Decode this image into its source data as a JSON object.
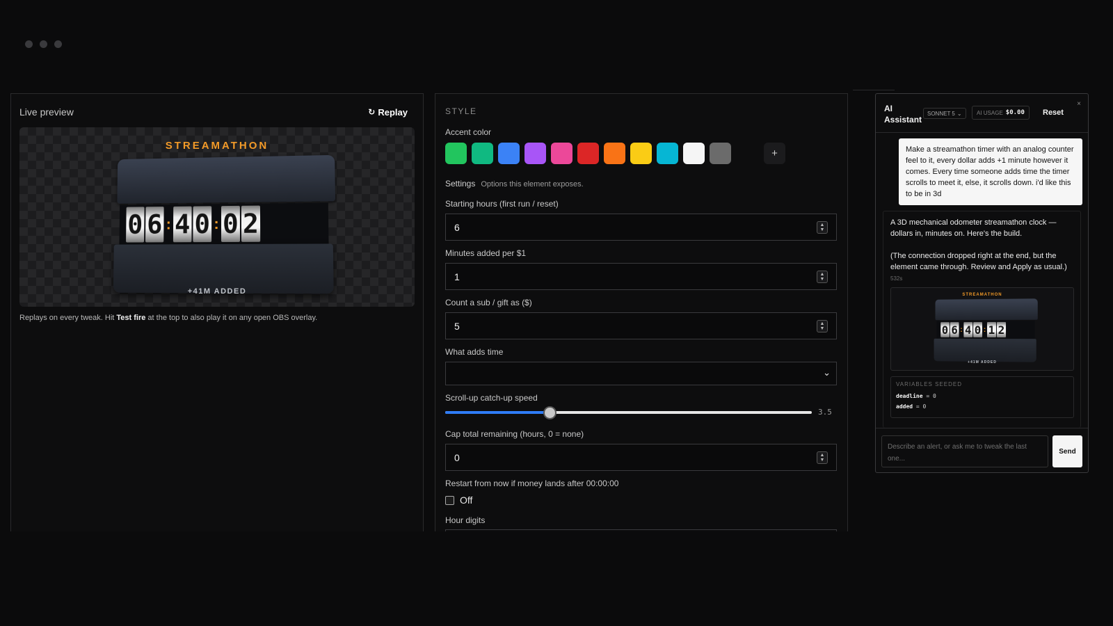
{
  "preview": {
    "title": "Live preview",
    "replay_icon": "↻",
    "replay_label": "Replay",
    "widget_title": "STREAMATHON",
    "digits": [
      "0",
      "6",
      "4",
      "0",
      "0",
      "2"
    ],
    "widget_added": "+41M ADDED",
    "note_before": "Replays on every tweak. Hit ",
    "note_strong": "Test fire",
    "note_after": " at the top to also play it on any open OBS overlay."
  },
  "style": {
    "section_title": "STYLE",
    "accent_label": "Accent color",
    "swatch_colors": [
      "#22c55e",
      "#10b981",
      "#3b82f6",
      "#a855f7",
      "#ec4899",
      "#dc2626",
      "#f97316",
      "#facc15",
      "#06b6d4",
      "#f5f5f5",
      "#6b6b6b"
    ],
    "add_swatch": "+",
    "settings_heading": "Settings",
    "settings_sub": "Options this element exposes.",
    "starting_hours_label": "Starting hours (first run / reset)",
    "starting_hours_value": "6",
    "minutes_per_dollar_label": "Minutes added per $1",
    "minutes_per_dollar_value": "1",
    "sub_gift_label": "Count a sub / gift as ($)",
    "sub_gift_value": "5",
    "what_adds_label": "What adds time",
    "what_adds_value": "",
    "scroll_speed_label": "Scroll-up catch-up speed",
    "scroll_speed_value": "3.5",
    "scroll_speed_fraction": 0.285,
    "cap_label": "Cap total remaining (hours, 0 = none)",
    "cap_value": "0",
    "restart_label": "Restart from now if money lands after 00:00:00",
    "restart_checkbox_label": "Off",
    "hour_digits_label": "Hour digits"
  },
  "ai": {
    "title_line1": "AI",
    "title_line2": "Assistant",
    "model": "SONNET 5",
    "usage_label": "AI USAGE",
    "usage_value": "$0.00",
    "reset_label": "Reset",
    "close_icon": "×",
    "user_message": "Make a streamathon timer with an analog counter feel to it, every dollar adds +1 minute however it comes. Every time someone adds time the timer scrolls to meet it, else, it scrolls down. i'd like this to be in 3d",
    "bot_message_p1": "A 3D mechanical odometer streamathon clock — dollars in, minutes on. Here's the build.",
    "bot_message_p2": "(The connection dropped right at the end, but the element came through. Review and Apply as usual.)",
    "bot_time": "532s",
    "mini_title": "STREAMATHON",
    "mini_digits": [
      "0",
      "6",
      "4",
      "0",
      "1",
      "2"
    ],
    "mini_added": "+41M ADDED",
    "vars_heading": "VARIABLES SEEDED",
    "var1_name": "deadline",
    "var1_value": "= 0",
    "var2_name": "added",
    "var2_value": "= 0",
    "input_placeholder": "Describe an alert, or ask me to tweak the last one...",
    "send_label": "Send"
  }
}
